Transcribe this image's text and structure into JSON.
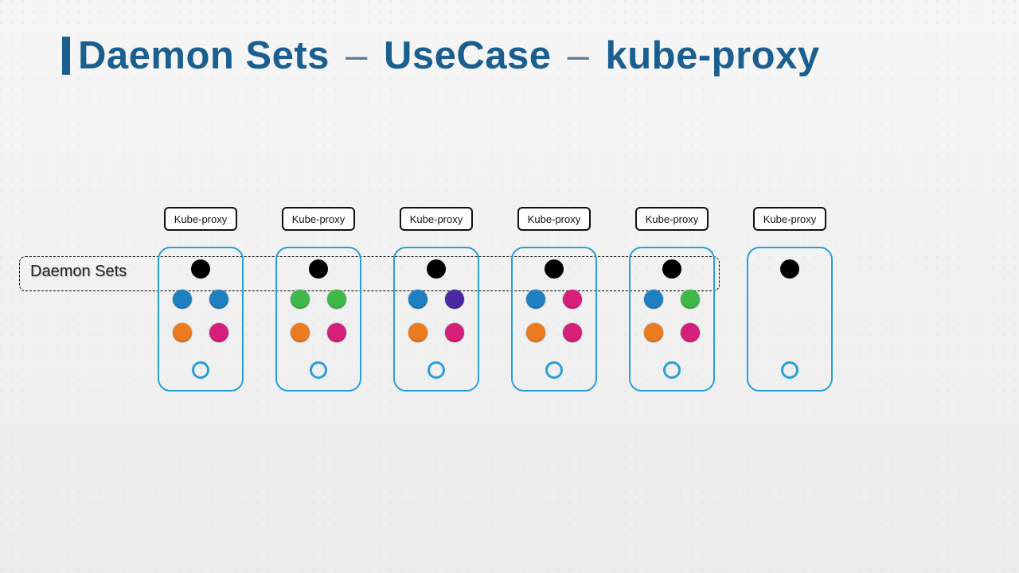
{
  "title": {
    "part1": "Daemon Sets",
    "dash": "–",
    "part2": "UseCase",
    "part3": "kube-proxy"
  },
  "ds_label": "Daemon Sets",
  "kp_label": "Kube-proxy",
  "nodes": [
    {
      "pods": [
        "#1f7fc0",
        "#1f7fc0",
        "#ec7a1e",
        "#d61f7a"
      ]
    },
    {
      "pods": [
        "#3fb84a",
        "#3fb84a",
        "#ec7a1e",
        "#d61f7a"
      ]
    },
    {
      "pods": [
        "#1f7fc0",
        "#4a2aa3",
        "#ec7a1e",
        "#d61f7a"
      ]
    },
    {
      "pods": [
        "#1f7fc0",
        "#d61f7a",
        "#ec7a1e",
        "#d61f7a"
      ]
    },
    {
      "pods": [
        "#1f7fc0",
        "#3fb84a",
        "#ec7a1e",
        "#d61f7a"
      ]
    },
    {
      "pods": []
    }
  ]
}
